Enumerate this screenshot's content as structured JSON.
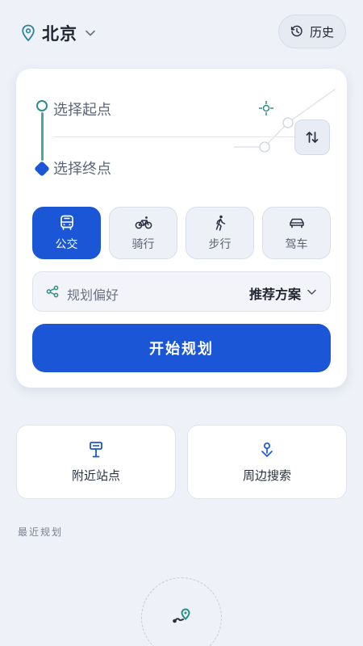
{
  "header": {
    "city": "北京",
    "history_label": "历史"
  },
  "route": {
    "origin_placeholder": "选择起点",
    "destination_placeholder": "选择终点"
  },
  "modes": [
    {
      "label": "公交",
      "icon": "bus-icon",
      "active": true
    },
    {
      "label": "骑行",
      "icon": "bicycle-icon",
      "active": false
    },
    {
      "label": "步行",
      "icon": "walk-icon",
      "active": false
    },
    {
      "label": "驾车",
      "icon": "car-icon",
      "active": false
    }
  ],
  "preference": {
    "label": "规划偏好",
    "value": "推荐方案"
  },
  "start_button": "开始规划",
  "shortcuts": [
    {
      "label": "附近站点",
      "icon": "bus-stop-icon"
    },
    {
      "label": "周边搜索",
      "icon": "nearby-pin-icon"
    }
  ],
  "recent": {
    "title": "最近规划"
  },
  "colors": {
    "primary": "#1a56d6",
    "accent_green": "#2a8f86",
    "background": "#eef1f7"
  }
}
